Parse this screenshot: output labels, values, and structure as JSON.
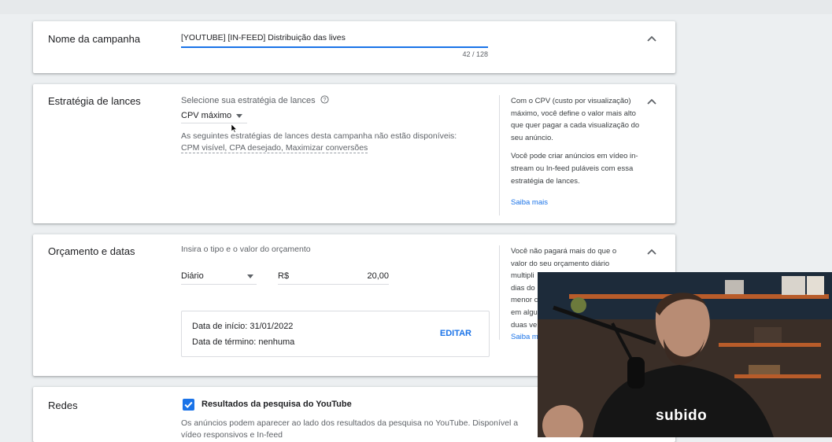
{
  "campaign_name": {
    "title": "Nome da campanha",
    "value": "[YOUTUBE] [IN-FEED] Distribuição das lives",
    "counter": "42 / 128"
  },
  "bidding": {
    "title": "Estratégia de lances",
    "select_label": "Selecione sua estratégia de lances",
    "selected": "CPV máximo",
    "unavailable_text": "As seguintes estratégias de lances desta campanha não estão disponíveis:",
    "unavailable_list": "CPM visível, CPA desejado, Maximizar conversões",
    "help_p1": "Com o CPV (custo por visualização) máximo, você define o valor mais alto que quer pagar a cada visualização do seu anúncio.",
    "help_p2": "Você pode criar anúncios em vídeo in-stream ou In-feed puláveis com essa estratégia de lances.",
    "help_link": "Saiba mais"
  },
  "budget": {
    "title": "Orçamento e datas",
    "label": "Insira o tipo e o valor do orçamento",
    "type": "Diário",
    "currency": "R$",
    "amount": "20,00",
    "start_date": "Data de início: 31/01/2022",
    "end_date": "Data de término: nenhuma",
    "edit_label": "EDITAR",
    "help_lines": [
      "Você não pagará mais do que o",
      "valor do seu orçamento diário",
      "multipli",
      "dias do",
      "menor c",
      "em algu",
      "duas ve"
    ],
    "help_link_partial": "Saiba m"
  },
  "networks": {
    "title": "Redes",
    "checkbox_label": "Resultados da pesquisa do YouTube",
    "checked": true,
    "desc_line1": "Os anúncios podem aparecer ao lado dos resultados da pesquisa no YouTube. Disponível a",
    "desc_line2": "vídeo responsivos e In-feed"
  },
  "webcam": {
    "shirt_text": "subido"
  },
  "colors": {
    "accent": "#1a73e8",
    "background": "#eceff1"
  }
}
